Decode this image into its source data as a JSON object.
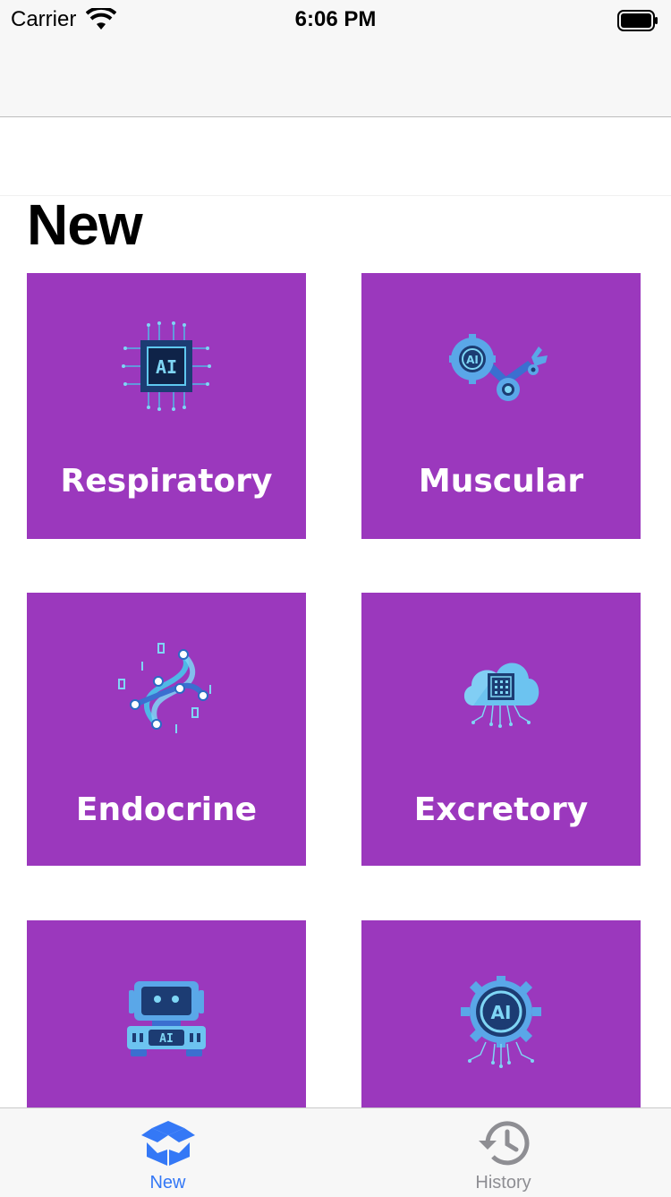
{
  "status_bar": {
    "carrier": "Carrier",
    "time": "6:06 PM"
  },
  "page": {
    "title": "New"
  },
  "cards": [
    {
      "label": "Respiratory",
      "icon": "ai-chip-icon"
    },
    {
      "label": "Muscular",
      "icon": "robotic-arm-gears-icon"
    },
    {
      "label": "Endocrine",
      "icon": "dna-icon"
    },
    {
      "label": "Excretory",
      "icon": "cloud-chip-icon"
    },
    {
      "label": "",
      "icon": "robot-icon"
    },
    {
      "label": "",
      "icon": "ai-gear-icon"
    }
  ],
  "tab_bar": {
    "tabs": [
      {
        "label": "New",
        "icon": "box-icon",
        "active": true
      },
      {
        "label": "History",
        "icon": "history-icon",
        "active": false
      }
    ]
  },
  "colors": {
    "card": "#9b38bd",
    "accent": "#3478f6",
    "inactive": "#8e8e93"
  }
}
